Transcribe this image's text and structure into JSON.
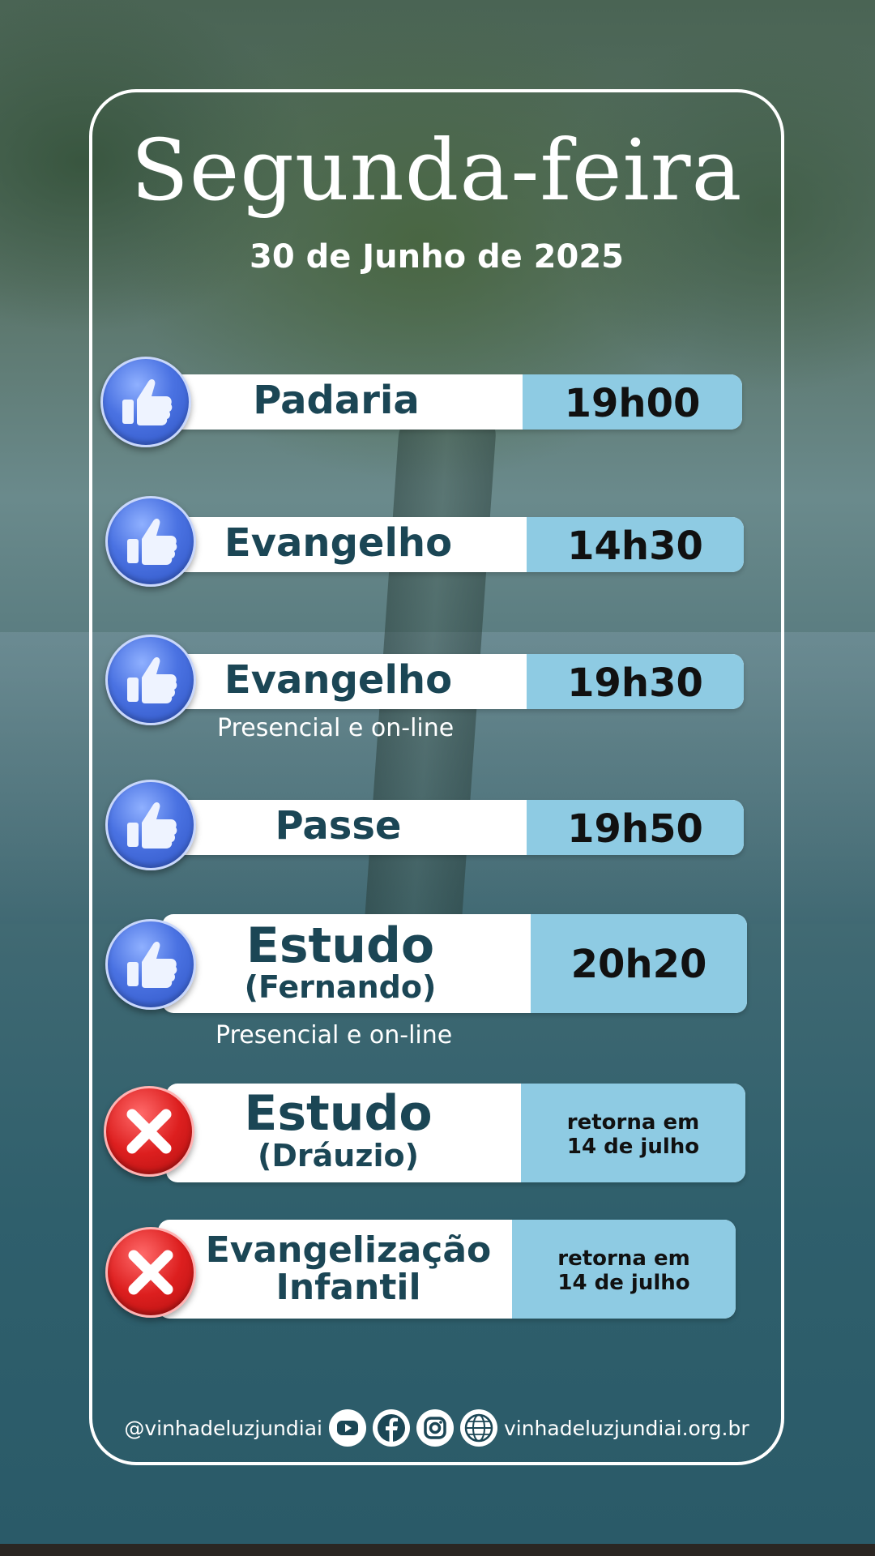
{
  "header": {
    "title": "Segunda-feira",
    "date": "30 de Junho de 2025"
  },
  "schedule": [
    {
      "icon": "thumbs-up-icon",
      "activity": "Padaria",
      "time": "19h00"
    },
    {
      "icon": "thumbs-up-icon",
      "activity": "Evangelho",
      "time": "14h30"
    },
    {
      "icon": "thumbs-up-icon",
      "activity": "Evangelho",
      "time": "19h30",
      "note": "Presencial e on-line"
    },
    {
      "icon": "thumbs-up-icon",
      "activity": "Passe",
      "time": "19h50"
    },
    {
      "icon": "thumbs-up-icon",
      "activity": "Estudo",
      "activity_sub": "(Fernando)",
      "time": "20h20",
      "note": "Presencial e on-line"
    },
    {
      "icon": "cancel-x-icon",
      "activity": "Estudo",
      "activity_sub": "(Dráuzio)",
      "time_line1": "retorna em",
      "time_line2": "14 de julho"
    },
    {
      "icon": "cancel-x-icon",
      "activity": "Evangelização",
      "activity_sub": "Infantil",
      "time_line1": "retorna em",
      "time_line2": "14 de julho"
    }
  ],
  "footer": {
    "handle": "@vinhadeluzjundiai",
    "icons": [
      "youtube-icon",
      "facebook-icon",
      "instagram-icon",
      "globe-icon"
    ],
    "website": "vinhadeluzjundiai.org.br"
  },
  "colors": {
    "activity_text": "#1b4655",
    "time_panel": "#8ecbe3",
    "like_icon": "#4a72e2",
    "cancel_icon": "#dd1f1f"
  }
}
